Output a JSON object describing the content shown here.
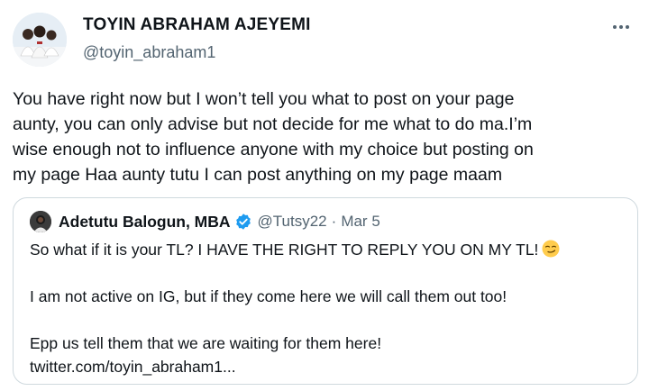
{
  "tweet": {
    "display_name": "TOYIN ABRAHAM AJEYEMI",
    "handle": "@toyin_abraham1",
    "text": "You have right now but I won’t tell you what to post on your page\naunty, you can only advise but not decide for me what to do ma.I’m\nwise enough not to influence anyone with my choice but posting on\nmy page Haa aunty tutu I can post anything on my page maam"
  },
  "quote": {
    "name": "Adetutu Balogun, MBA",
    "handle": "@Tutsy22",
    "separator": "·",
    "date": "Mar 5",
    "lines": [
      "So what if it is your TL? I HAVE THE RIGHT TO REPLY YOU ON MY TL!",
      "I am not active on IG, but if they come here we will call them out too!",
      "Epp us tell them that we are waiting for them here!",
      "twitter.com/toyin_abraham1..."
    ],
    "emoji": "smirking-face"
  },
  "icons": {
    "more": "more-icon",
    "verified": "verified-badge-icon"
  },
  "colors": {
    "text": "#0f1419",
    "secondary": "#536471",
    "border": "#cfd9de",
    "verified": "#1d9bf0"
  }
}
